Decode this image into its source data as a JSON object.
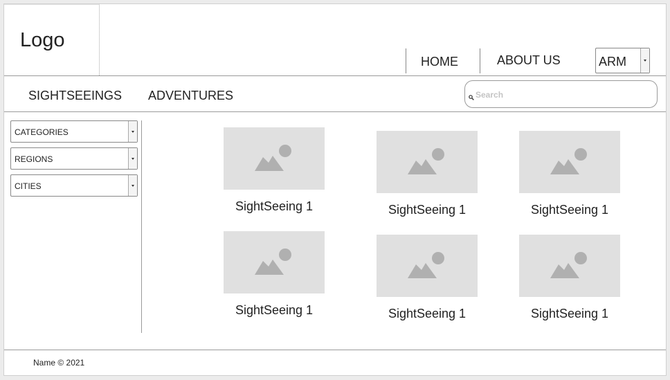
{
  "header": {
    "logo": "Logo",
    "nav": [
      {
        "label": "HOME"
      },
      {
        "label": "ABOUT US"
      }
    ],
    "language": {
      "selected": "ARM"
    }
  },
  "subnav": {
    "tabs": [
      {
        "label": "SIGHTSEEINGS"
      },
      {
        "label": "ADVENTURES"
      }
    ],
    "search": {
      "placeholder": "Search",
      "value": ""
    }
  },
  "sidebar": {
    "filters": [
      {
        "label": "CATEGORIES"
      },
      {
        "label": "REGIONS"
      },
      {
        "label": "CITIES"
      }
    ]
  },
  "cards": [
    {
      "title": "SightSeeing 1",
      "icon": "image-placeholder-icon"
    },
    {
      "title": "SightSeeing 1",
      "icon": "image-placeholder-icon"
    },
    {
      "title": "SightSeeing 1",
      "icon": "image-placeholder-icon"
    },
    {
      "title": "SightSeeing 1",
      "icon": "image-placeholder-icon"
    },
    {
      "title": "SightSeeing 1",
      "icon": "image-placeholder-icon"
    },
    {
      "title": "SightSeeing 1",
      "icon": "image-placeholder-icon"
    }
  ],
  "footer": {
    "text": "Name © 2021"
  },
  "colors": {
    "placeholder_bg": "#e0e0e0",
    "placeholder_icon": "#b0b0b0",
    "border": "#9a9a9a"
  }
}
